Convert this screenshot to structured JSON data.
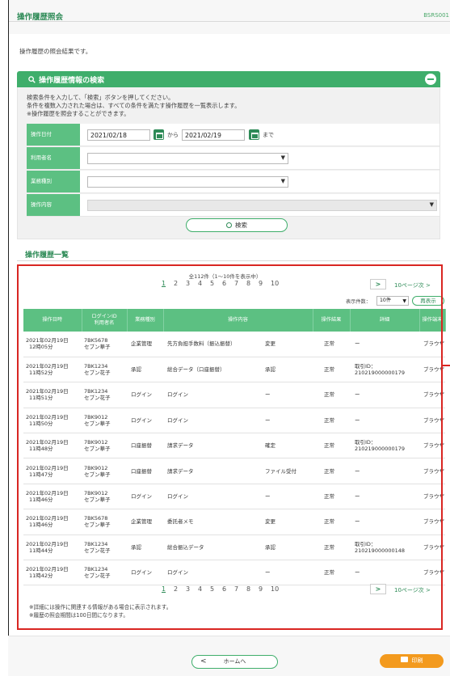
{
  "header": {
    "title": "操作履歴照会",
    "screen_code": "BSRS001"
  },
  "intro": "操作履歴の照会結果です。",
  "search": {
    "title": "操作履歴情報の検索",
    "instructions": [
      "検索条件を入力して、「検索」ボタンを押してください。",
      "条件を複数入力された場合は、すべての条件を満たす操作履歴を一覧表示します。",
      "※操作履歴を照会することができます。"
    ],
    "labels": {
      "date": "操作日付",
      "user": "利用者名",
      "category": "業務種別",
      "content": "操作内容"
    },
    "date_from": "2021/02/18",
    "date_to": "2021/02/19",
    "from_text": "から",
    "to_text": "まで",
    "button": "検索"
  },
  "list": {
    "title": "操作履歴一覧",
    "total": "全112件（1～10件を表示中）",
    "pages": [
      "1",
      "2",
      "3",
      "4",
      "5",
      "6",
      "7",
      "8",
      "9",
      "10"
    ],
    "next_icon": "chevron-right-icon",
    "next10": "10ページ次",
    "count_label": "表示件数：",
    "count_value": "10件",
    "redisplay": "再表示",
    "headers": [
      "操作日時",
      "ログインID",
      "利用者名",
      "業務種別",
      "操作内容",
      "操作結果",
      "詳細",
      "操作端末"
    ],
    "rows": [
      {
        "date": "2021年02月19日",
        "time": "12時05分",
        "id": "7BK5678",
        "user": "セブン華子",
        "cat": "企業管理",
        "content": "先方負担手数料（振込振替）",
        "action": "変更",
        "result": "正常",
        "detail1": "ー",
        "detail2": "",
        "device": "ブラウザ"
      },
      {
        "date": "2021年02月19日",
        "time": "11時52分",
        "id": "7BK1234",
        "user": "セブン花子",
        "cat": "承認",
        "content": "総合データ（口座振替）",
        "action": "承認",
        "result": "正常",
        "detail1": "取引ID：",
        "detail2": "210219000000179",
        "device": "ブラウザ"
      },
      {
        "date": "2021年02月19日",
        "time": "11時51分",
        "id": "7BK1234",
        "user": "セブン花子",
        "cat": "ログイン",
        "content": "ログイン",
        "action": "ー",
        "result": "正常",
        "detail1": "ー",
        "detail2": "",
        "device": "ブラウザ"
      },
      {
        "date": "2021年02月19日",
        "time": "11時50分",
        "id": "7BK9012",
        "user": "セブン華子",
        "cat": "ログイン",
        "content": "ログイン",
        "action": "ー",
        "result": "正常",
        "detail1": "ー",
        "detail2": "",
        "device": "ブラウザ"
      },
      {
        "date": "2021年02月19日",
        "time": "11時48分",
        "id": "7BK9012",
        "user": "セブン華子",
        "cat": "口座振替",
        "content": "請求データ",
        "action": "確定",
        "result": "正常",
        "detail1": "取引ID：",
        "detail2": "210219000000179",
        "device": "ブラウザ"
      },
      {
        "date": "2021年02月19日",
        "time": "11時47分",
        "id": "7BK9012",
        "user": "セブン華子",
        "cat": "口座振替",
        "content": "請求データ",
        "action": "ファイル受付",
        "result": "正常",
        "detail1": "ー",
        "detail2": "",
        "device": "ブラウザ"
      },
      {
        "date": "2021年02月19日",
        "time": "11時46分",
        "id": "7BK9012",
        "user": "セブン華子",
        "cat": "ログイン",
        "content": "ログイン",
        "action": "ー",
        "result": "正常",
        "detail1": "ー",
        "detail2": "",
        "device": "ブラウザ"
      },
      {
        "date": "2021年02月19日",
        "time": "11時46分",
        "id": "7BK5678",
        "user": "セブン華子",
        "cat": "企業管理",
        "content": "委託者メモ",
        "action": "変更",
        "result": "正常",
        "detail1": "ー",
        "detail2": "",
        "device": "ブラウザ"
      },
      {
        "date": "2021年02月19日",
        "time": "11時44分",
        "id": "7BK1234",
        "user": "セブン花子",
        "cat": "承認",
        "content": "総合振込データ",
        "action": "承認",
        "result": "正常",
        "detail1": "取引ID：",
        "detail2": "210219000000148",
        "device": "ブラウザ"
      },
      {
        "date": "2021年02月19日",
        "time": "11時42分",
        "id": "7BK1234",
        "user": "セブン花子",
        "cat": "ログイン",
        "content": "ログイン",
        "action": "ー",
        "result": "正常",
        "detail1": "ー",
        "detail2": "",
        "device": "ブラウザ"
      }
    ],
    "notes": [
      "※詳細には操作に関連する情報がある場合に表示されます。",
      "※履歴の照会期間は100日間になります。"
    ]
  },
  "footer": {
    "home": "ホームへ",
    "print": "印刷"
  },
  "colors": {
    "brand": "#2e8b57",
    "header_green": "#3fae6b",
    "label_green": "#5cc082",
    "print_orange": "#f39a1e",
    "highlight_red": "#d92622"
  }
}
